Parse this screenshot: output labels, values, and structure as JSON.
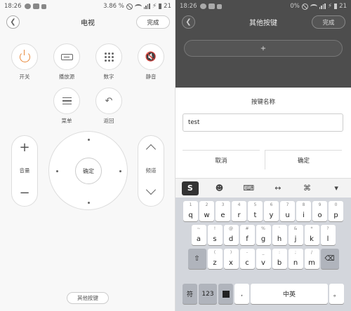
{
  "left": {
    "status": {
      "time": "18:26",
      "battery_pct": "3.86 %",
      "battery_level": "21"
    },
    "title": "电视",
    "done_label": "完成",
    "buttons": {
      "power": "开关",
      "source": "播放源",
      "numbers": "数字",
      "mute": "静音",
      "menu": "菜单",
      "back": "返回",
      "ok": "确定"
    },
    "volume_label": "音量",
    "channel_label": "频道",
    "other_keys": "其他按键"
  },
  "right": {
    "status": {
      "time": "18:26",
      "battery_pct": "0%",
      "battery_level": "21"
    },
    "title": "其他按键",
    "done_label": "完成",
    "add_symbol": "+",
    "dialog": {
      "title": "按键名称",
      "input_value": "test",
      "cancel_label": "取消",
      "confirm_label": "确定"
    },
    "keyboard": {
      "row1": [
        {
          "k": "q",
          "s": "1"
        },
        {
          "k": "w",
          "s": "2"
        },
        {
          "k": "e",
          "s": "3"
        },
        {
          "k": "r",
          "s": "4"
        },
        {
          "k": "t",
          "s": "5"
        },
        {
          "k": "y",
          "s": "6"
        },
        {
          "k": "u",
          "s": "7"
        },
        {
          "k": "i",
          "s": "8"
        },
        {
          "k": "o",
          "s": "9"
        },
        {
          "k": "p",
          "s": "0"
        }
      ],
      "row2": [
        {
          "k": "a",
          "s": "~"
        },
        {
          "k": "s",
          "s": "!"
        },
        {
          "k": "d",
          "s": "@"
        },
        {
          "k": "f",
          "s": "#"
        },
        {
          "k": "g",
          "s": "%"
        },
        {
          "k": "h",
          "s": "'"
        },
        {
          "k": "j",
          "s": "&"
        },
        {
          "k": "k",
          "s": "*"
        },
        {
          "k": "l",
          "s": "?"
        }
      ],
      "row3": [
        {
          "k": "z",
          "s": "("
        },
        {
          "k": "x",
          "s": ")"
        },
        {
          "k": "c",
          "s": "-"
        },
        {
          "k": "v",
          "s": "_"
        },
        {
          "k": "b",
          "s": ":"
        },
        {
          "k": "n",
          "s": ";"
        },
        {
          "k": "m",
          "s": "/"
        }
      ],
      "bottom": {
        "symbol": "符",
        "num": "123",
        "comma": ",",
        "space": "中英",
        "period": "。"
      }
    }
  }
}
